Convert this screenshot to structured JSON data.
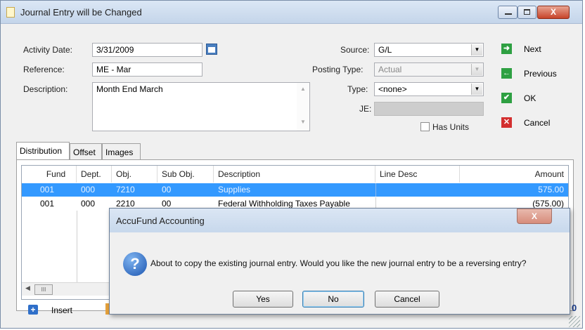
{
  "window": {
    "title": "Journal Entry will be Changed",
    "close_glyph": "X"
  },
  "form": {
    "activity_date_label": "Activity Date:",
    "activity_date_value": "3/31/2009",
    "reference_label": "Reference:",
    "reference_value": "ME - Mar",
    "description_label": "Description:",
    "description_value": "Month End March",
    "source_label": "Source:",
    "source_value": "G/L",
    "posting_type_label": "Posting Type:",
    "posting_type_value": "Actual",
    "type_label": "Type:",
    "type_value": "<none>",
    "je_label": "JE:",
    "je_value": "",
    "has_units_label": "Has Units"
  },
  "nav": {
    "next": "Next",
    "previous": "Previous",
    "ok": "OK",
    "cancel": "Cancel"
  },
  "tabs": [
    "Distribution",
    "Offset",
    "Images"
  ],
  "grid": {
    "columns": [
      "Fund",
      "Dept.",
      "Obj.",
      "Sub Obj.",
      "Description",
      "Line Desc",
      "Amount"
    ],
    "rows": [
      {
        "fund": "001",
        "dept": "000",
        "obj": "7210",
        "subobj": "00",
        "desc": "Supplies",
        "linedesc": "",
        "amount": "575.00"
      },
      {
        "fund": "001",
        "dept": "000",
        "obj": "2210",
        "subobj": "00",
        "desc": "Federal Withholding Taxes Payable",
        "linedesc": "",
        "amount": "(575.00)"
      }
    ],
    "hscroll_glyph": "III"
  },
  "bottom": {
    "insert_label": "Insert",
    "right_fragment": "0"
  },
  "dialog": {
    "title": "AccuFund Accounting",
    "message": "About to copy the existing journal entry. Would you like the new journal entry to be a reversing entry?",
    "yes": "Yes",
    "no": "No",
    "cancel": "Cancel",
    "close_glyph": "X"
  },
  "colors": {
    "selection": "#3399ff",
    "next_icon": "#2ea042",
    "prev_icon": "#2ea042",
    "ok_icon": "#2ea042",
    "cancel_icon": "#d32f2f"
  }
}
